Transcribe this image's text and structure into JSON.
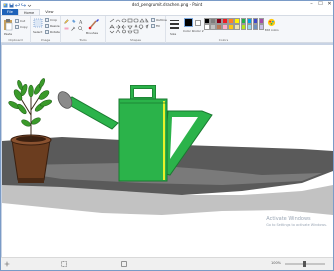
{
  "window": {
    "title": "dsd_pengrumit.drachen.png - Paint",
    "controls": [
      "–",
      "☐",
      "✕"
    ]
  },
  "tabs": [
    {
      "label": "File"
    },
    {
      "label": "Home"
    },
    {
      "label": "View"
    }
  ],
  "ribbon": {
    "groups": [
      {
        "label": "Clipboard",
        "buttons": [
          "Paste",
          "Cut",
          "Copy"
        ]
      },
      {
        "label": "Image",
        "buttons": [
          "Select",
          "Crop",
          "Resize",
          "Rotate"
        ]
      },
      {
        "label": "Tools",
        "buttons": []
      },
      {
        "label": "Shapes",
        "buttons": [
          "Outline",
          "Fill"
        ]
      },
      {
        "label": "Colors",
        "buttons": [
          "Size",
          "Color 1",
          "Color 2",
          "Edit colors"
        ]
      }
    ],
    "brushes_label": "Brushes",
    "palette": [
      "#000000",
      "#7f7f7f",
      "#880015",
      "#ed1c24",
      "#ff7f27",
      "#fff200",
      "#22b14c",
      "#00a2e8",
      "#3f48cc",
      "#a349a4",
      "#ffffff",
      "#c3c3c3",
      "#b97a57",
      "#ffaec9",
      "#ffc90e",
      "#efe4b0",
      "#b5e61d",
      "#99d9ea",
      "#7092be",
      "#c8bfe7"
    ]
  },
  "activate": {
    "line1": "Activate Windows",
    "line2": "Go to Settings to activate Windows."
  },
  "status": {
    "zoom": "100%"
  },
  "colors": {
    "accent": "#1e62b9",
    "can_green": "#2bb34a",
    "can_dark": "#1a7a30",
    "can_edge": "#e8f02a",
    "pot": "#6b3d1f",
    "ground": "#5a5a5a"
  }
}
